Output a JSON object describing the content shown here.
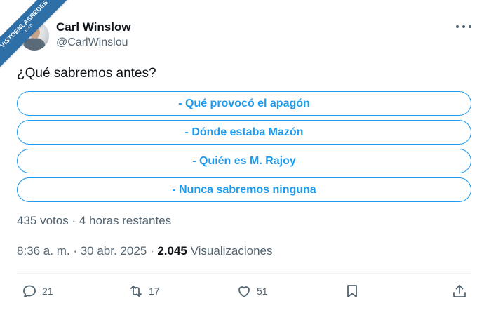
{
  "watermark": {
    "line1": "VISTOENLASREDES",
    "line2": ".com"
  },
  "author": {
    "name": "Carl Winslow",
    "handle": "@CarlWinslou",
    "avatar_icon": "profile-photo"
  },
  "post": {
    "question": "¿Qué sabremos antes?",
    "poll": {
      "options": [
        "- Qué provocó el apagón",
        "- Dónde estaba Mazón",
        "- Quién es M. Rajoy",
        "- Nunca sabremos ninguna"
      ],
      "meta": "435 votos · 4 horas restantes"
    },
    "timestamp": "8:36 a. m. · 30 abr. 2025 · ",
    "views_count": "2.045",
    "views_label": "Visualizaciones"
  },
  "actions": {
    "reply_count": "21",
    "repost_count": "17",
    "like_count": "51"
  },
  "colors": {
    "accent": "#1d9bf0",
    "secondary_text": "#536471",
    "primary_text": "#0f1419"
  }
}
